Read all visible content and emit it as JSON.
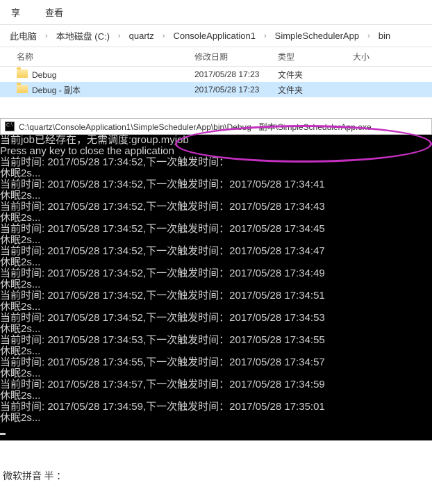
{
  "toolbar": {
    "share": "享",
    "view": "查看"
  },
  "breadcrumb": [
    "此电脑",
    "本地磁盘 (C:)",
    "quartz",
    "ConsoleApplication1",
    "SimpleSchedulerApp",
    "bin"
  ],
  "columns": {
    "name": "名称",
    "date": "修改日期",
    "type": "类型",
    "size": "大小"
  },
  "rows": [
    {
      "name": "Debug",
      "date": "2017/05/28 17:23",
      "type": "文件夹",
      "size": "",
      "selected": false
    },
    {
      "name": "Debug - 副本",
      "date": "2017/05/28 17:23",
      "type": "文件夹",
      "size": "",
      "selected": true
    }
  ],
  "console": {
    "title": "C:\\quartz\\ConsoleApplication1\\SimpleSchedulerApp\\bin\\Debug - 副本\\SimpleSchedulerApp.exe",
    "lines": [
      "当前job已经存在，无需调度:group.myjob",
      "Press any key to close the application",
      "当前时间: 2017/05/28 17:34:52,下一次触发时间：",
      "休眠2s...",
      "当前时间: 2017/05/28 17:34:52,下一次触发时间：2017/05/28 17:34:41",
      "休眠2s...",
      "当前时间: 2017/05/28 17:34:52,下一次触发时间：2017/05/28 17:34:43",
      "休眠2s...",
      "当前时间: 2017/05/28 17:34:52,下一次触发时间：2017/05/28 17:34:45",
      "休眠2s...",
      "当前时间: 2017/05/28 17:34:52,下一次触发时间：2017/05/28 17:34:47",
      "休眠2s...",
      "当前时间: 2017/05/28 17:34:52,下一次触发时间：2017/05/28 17:34:49",
      "休眠2s...",
      "当前时间: 2017/05/28 17:34:52,下一次触发时间：2017/05/28 17:34:51",
      "休眠2s...",
      "当前时间: 2017/05/28 17:34:52,下一次触发时间：2017/05/28 17:34:53",
      "休眠2s...",
      "当前时间: 2017/05/28 17:34:53,下一次触发时间：2017/05/28 17:34:55",
      "休眠2s...",
      "当前时间: 2017/05/28 17:34:55,下一次触发时间：2017/05/28 17:34:57",
      "休眠2s...",
      "当前时间: 2017/05/28 17:34:57,下一次触发时间：2017/05/28 17:34:59",
      "休眠2s...",
      "当前时间: 2017/05/28 17:34:59,下一次触发时间：2017/05/28 17:35:01",
      "休眠2s..."
    ]
  },
  "ime": "微软拼音 半 ："
}
